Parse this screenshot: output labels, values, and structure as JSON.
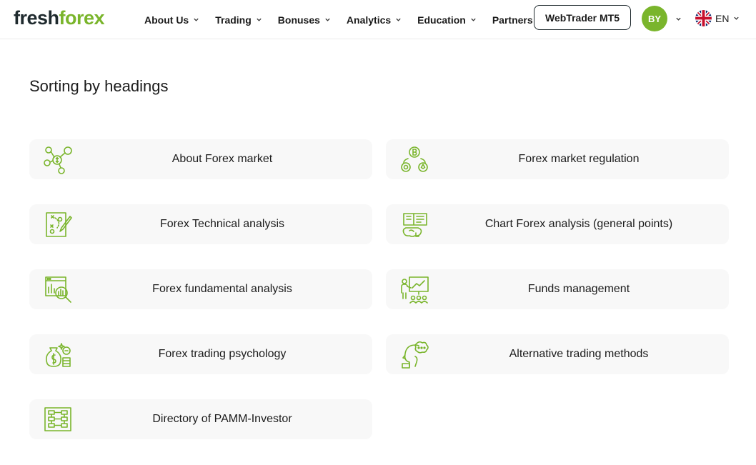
{
  "header": {
    "logo": {
      "part1": "fresh",
      "part2": "forex"
    },
    "nav": [
      {
        "label": "About Us",
        "has_dropdown": true
      },
      {
        "label": "Trading",
        "has_dropdown": true
      },
      {
        "label": "Bonuses",
        "has_dropdown": true
      },
      {
        "label": "Analytics",
        "has_dropdown": true
      },
      {
        "label": "Education",
        "has_dropdown": true
      },
      {
        "label": "Partners",
        "has_dropdown": false
      }
    ],
    "webtrader_label": "WebTrader MT5",
    "avatar_initials": "BY",
    "language": "EN"
  },
  "main": {
    "title": "Sorting by headings",
    "categories": [
      {
        "label": "About Forex market",
        "icon": "network-coins-icon"
      },
      {
        "label": "Forex market regulation",
        "icon": "crypto-coins-icon"
      },
      {
        "label": "Forex Technical analysis",
        "icon": "strategy-board-icon"
      },
      {
        "label": "Chart Forex analysis (general points)",
        "icon": "brain-book-icon"
      },
      {
        "label": "Forex fundamental analysis",
        "icon": "chart-magnifier-icon"
      },
      {
        "label": "Funds management",
        "icon": "presentation-icon"
      },
      {
        "label": "Forex trading psychology",
        "icon": "money-bag-icon"
      },
      {
        "label": "Alternative trading methods",
        "icon": "head-thought-icon"
      },
      {
        "label": "Directory of PAMM-Investor",
        "icon": "flowchart-icon"
      }
    ]
  },
  "colors": {
    "brand_green": "#7ab52c",
    "dark": "#1f2a2e",
    "card_bg": "#f8f8f8"
  }
}
